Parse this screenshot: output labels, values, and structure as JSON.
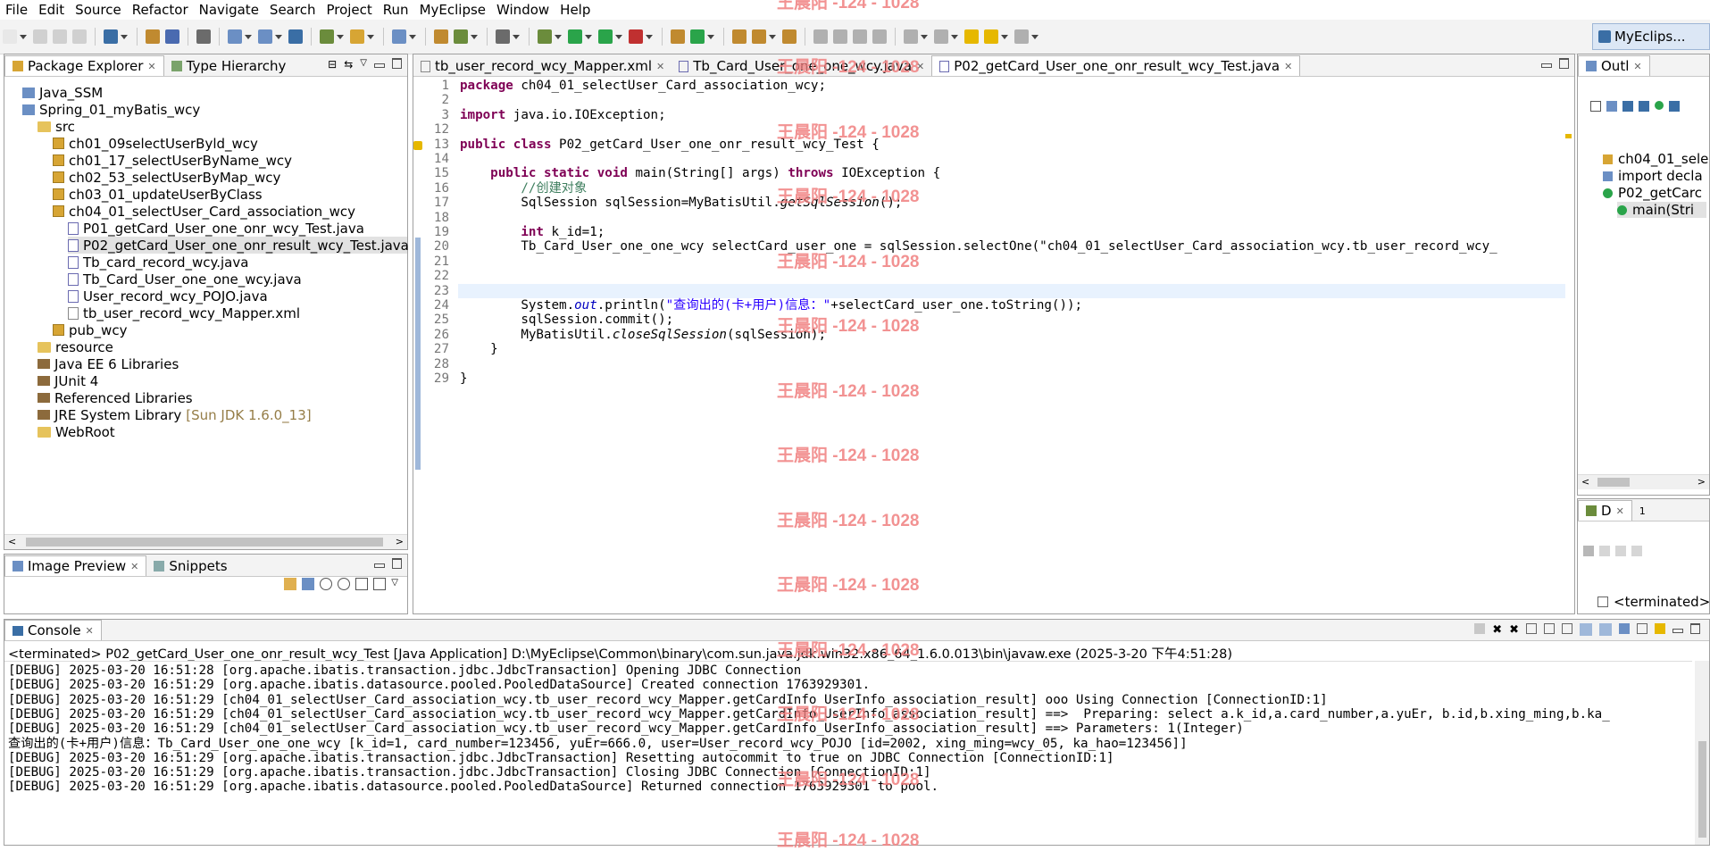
{
  "menu": [
    "File",
    "Edit",
    "Source",
    "Refactor",
    "Navigate",
    "Search",
    "Project",
    "Run",
    "MyEclipse",
    "Window",
    "Help"
  ],
  "perspective": {
    "label": "MyEclips..."
  },
  "package_explorer": {
    "tabs": [
      {
        "label": "Package Explorer"
      },
      {
        "label": "Type Hierarchy"
      }
    ],
    "tree": [
      {
        "label": "Java_SSM",
        "icon": "project-icon",
        "indent": 0
      },
      {
        "label": "Spring_01_myBatis_wcy",
        "icon": "project-icon",
        "indent": 0
      },
      {
        "label": "src",
        "icon": "source-folder-icon",
        "indent": 1
      },
      {
        "label": "ch01_09selectUserByld_wcy",
        "icon": "package-icon",
        "indent": 2
      },
      {
        "label": "ch01_17_selectUserByName_wcy",
        "icon": "package-icon",
        "indent": 2
      },
      {
        "label": "ch02_53_selectUserByMap_wcy",
        "icon": "package-icon",
        "indent": 2
      },
      {
        "label": "ch03_01_updateUserByClass",
        "icon": "package-icon",
        "indent": 2
      },
      {
        "label": "ch04_01_selectUser_Card_association_wcy",
        "icon": "package-icon",
        "indent": 2
      },
      {
        "label": "P01_getCard_User_one_onr_wcy_Test.java",
        "icon": "java-file-icon",
        "indent": 3
      },
      {
        "label": "P02_getCard_User_one_onr_result_wcy_Test.java",
        "icon": "java-file-icon",
        "indent": 3,
        "selected": true
      },
      {
        "label": "Tb_card_record_wcy.java",
        "icon": "java-file-icon",
        "indent": 3
      },
      {
        "label": "Tb_Card_User_one_one_wcy.java",
        "icon": "java-file-icon",
        "indent": 3
      },
      {
        "label": "User_record_wcy_POJO.java",
        "icon": "java-file-icon",
        "indent": 3
      },
      {
        "label": "tb_user_record_wcy_Mapper.xml",
        "icon": "xml-file-icon",
        "indent": 3
      },
      {
        "label": "pub_wcy",
        "icon": "package-icon",
        "indent": 2
      },
      {
        "label": "resource",
        "icon": "source-folder-icon",
        "indent": 1
      },
      {
        "label": "Java EE 6 Libraries",
        "icon": "library-icon",
        "indent": 1
      },
      {
        "label": "JUnit 4",
        "icon": "library-icon",
        "indent": 1
      },
      {
        "label": "Referenced Libraries",
        "icon": "library-icon",
        "indent": 1
      },
      {
        "label": "JRE System Library",
        "suffix": "[Sun JDK 1.6.0_13]",
        "icon": "library-icon",
        "indent": 1
      },
      {
        "label": "WebRoot",
        "icon": "folder-icon",
        "indent": 1
      }
    ]
  },
  "image_preview": {
    "tabs": [
      {
        "label": "Image Preview"
      },
      {
        "label": "Snippets"
      }
    ]
  },
  "editor": {
    "tabs": [
      {
        "label": "tb_user_record_wcy_Mapper.xml"
      },
      {
        "label": "Tb_Card_User_one_one_wcy.java"
      },
      {
        "label": "P02_getCard_User_one_onr_result_wcy_Test.java",
        "active": true
      }
    ],
    "lines": [
      {
        "n": "1",
        "text": "package ch04_01_selectUser_Card_association_wcy;"
      },
      {
        "n": "2",
        "text": ""
      },
      {
        "n": "3",
        "text": "import java.io.IOException;"
      },
      {
        "n": "12",
        "text": ""
      },
      {
        "n": "13",
        "text": "public class P02_getCard_User_one_onr_result_wcy_Test {"
      },
      {
        "n": "14",
        "text": ""
      },
      {
        "n": "15",
        "text": "    public static void main(String[] args) throws IOException {"
      },
      {
        "n": "16",
        "text": "        //创建对象"
      },
      {
        "n": "17",
        "text": "        SqlSession sqlSession=MyBatisUtil.getSqlSession();"
      },
      {
        "n": "18",
        "text": ""
      },
      {
        "n": "19",
        "text": "        int k_id=1;"
      },
      {
        "n": "20",
        "text": "        Tb_Card_User_one_one_wcy selectCard_user_one = sqlSession.selectOne(\"ch04_01_selectUser_Card_association_wcy.tb_user_record_wcy_"
      },
      {
        "n": "21",
        "text": ""
      },
      {
        "n": "22",
        "text": ""
      },
      {
        "n": "23",
        "text": ""
      },
      {
        "n": "24",
        "text": "        System.out.println(\"查询出的(卡+用户)信息：\"+selectCard_user_one.toString());"
      },
      {
        "n": "25",
        "text": "        sqlSession.commit();"
      },
      {
        "n": "26",
        "text": "        MyBatisUtil.closeSqlSession(sqlSession);"
      },
      {
        "n": "27",
        "text": "    }"
      },
      {
        "n": "28",
        "text": ""
      },
      {
        "n": "29",
        "text": "}"
      }
    ]
  },
  "outline": {
    "tab": "Outl",
    "items": [
      {
        "label": "ch04_01_sele"
      },
      {
        "label": "import decla"
      },
      {
        "label": "P02_getCarc"
      },
      {
        "label": "main(Stri"
      }
    ]
  },
  "debug_view": {
    "tab": "D",
    "tab2": "1",
    "item": "<terminated>"
  },
  "console": {
    "tab": "Console",
    "header": "<terminated> P02_getCard_User_one_onr_result_wcy_Test [Java Application] D:\\MyEclipse\\Common\\binary\\com.sun.java.jdk.win32.x86_64_1.6.0.013\\bin\\javaw.exe (2025-3-20 下午4:51:28)",
    "lines": [
      "[DEBUG] 2025-03-20 16:51:28 [org.apache.ibatis.transaction.jdbc.JdbcTransaction] Opening JDBC Connection",
      "[DEBUG] 2025-03-20 16:51:29 [org.apache.ibatis.datasource.pooled.PooledDataSource] Created connection 1763929301.",
      "[DEBUG] 2025-03-20 16:51:29 [ch04_01_selectUser_Card_association_wcy.tb_user_record_wcy_Mapper.getCardInfo_UserInfo_association_result] ooo Using Connection [ConnectionID:1]",
      "[DEBUG] 2025-03-20 16:51:29 [ch04_01_selectUser_Card_association_wcy.tb_user_record_wcy_Mapper.getCardInfo_UserInfo_association_result] ==>  Preparing: select a.k_id,a.card_number,a.yuEr, b.id,b.xing_ming,b.ka_",
      "[DEBUG] 2025-03-20 16:51:29 [ch04_01_selectUser_Card_association_wcy.tb_user_record_wcy_Mapper.getCardInfo_UserInfo_association_result] ==> Parameters: 1(Integer)",
      "查询出的(卡+用户)信息：Tb_Card_User_one_one_wcy [k_id=1, card_number=123456, yuEr=666.0, user=User_record_wcy_POJO [id=2002, xing_ming=wcy_05, ka_hao=123456]]",
      "[DEBUG] 2025-03-20 16:51:29 [org.apache.ibatis.transaction.jdbc.JdbcTransaction] Resetting autocommit to true on JDBC Connection [ConnectionID:1]",
      "[DEBUG] 2025-03-20 16:51:29 [org.apache.ibatis.transaction.jdbc.JdbcTransaction] Closing JDBC Connection [ConnectionID:1]",
      "[DEBUG] 2025-03-20 16:51:29 [org.apache.ibatis.datasource.pooled.PooledDataSource] Returned connection 1763929301 to pool."
    ]
  },
  "watermark": "王晨阳 -124 - 1028",
  "colors": {
    "keyword": "#7f0055",
    "comment": "#3f7f5f",
    "string": "#2a00ff",
    "field": "#0000c0",
    "watermark": "#f08080"
  }
}
